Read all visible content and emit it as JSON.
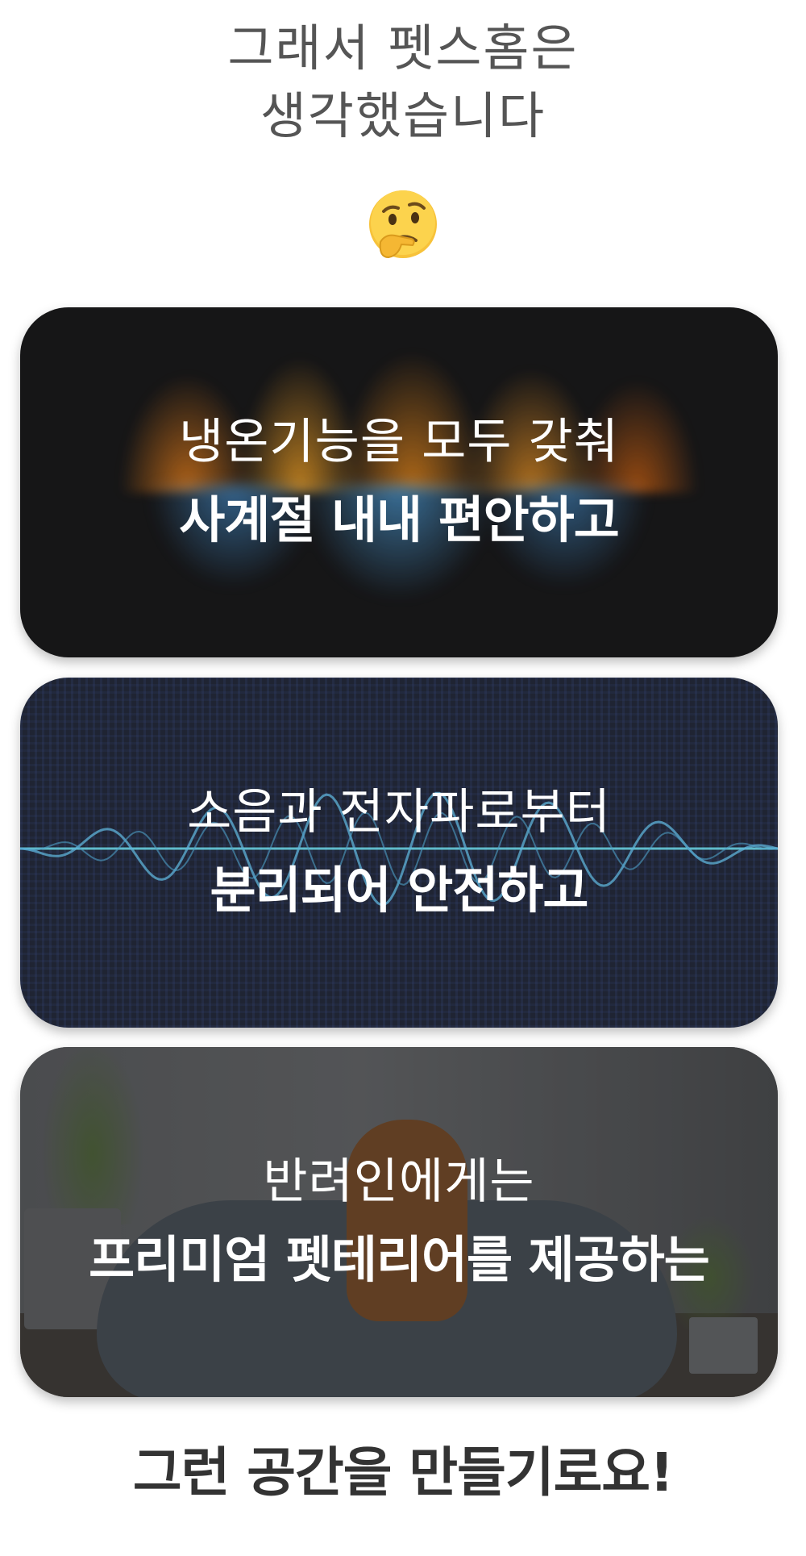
{
  "intro": {
    "line1": "그래서 펫스홈은",
    "line2": "생각했습니다",
    "emoji": "🤔",
    "emoji_icon": "thinking-face-icon"
  },
  "cards": [
    {
      "line1": "냉온기능을 모두 갖춰",
      "line2": "사계절 내내 편안하고",
      "background": "fire-and-water-image"
    },
    {
      "line1": "소음과 전자파로부터",
      "line2": "분리되어 안전하고",
      "background": "sound-wave-image",
      "accent": "#5fb3d9"
    },
    {
      "line1": "반려인에게는",
      "line2": "프리미엄 펫테리어를 제공하는",
      "background": "dog-on-bed-image"
    }
  ],
  "outro": {
    "text": "그런 공간을 만들기로요!"
  },
  "colors": {
    "intro_text": "#555555",
    "outro_text": "#333333",
    "card_text": "#ffffff"
  }
}
